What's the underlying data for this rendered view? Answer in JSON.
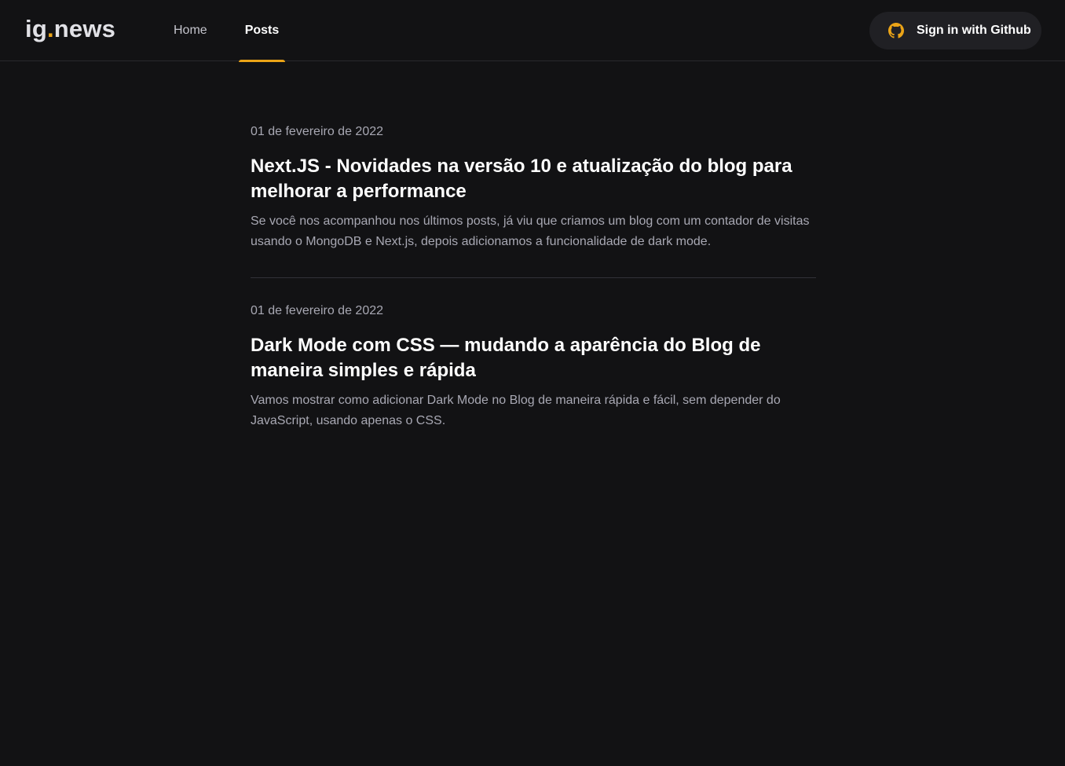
{
  "header": {
    "logo_text": "ig",
    "logo_dot": ".",
    "logo_suffix": "news",
    "nav": [
      {
        "label": "Home",
        "active": false
      },
      {
        "label": "Posts",
        "active": true
      }
    ],
    "signin_label": "Sign in with Github",
    "signin_icon": "github-icon",
    "accent_color": "#eba417"
  },
  "posts": [
    {
      "date": "01 de fevereiro de 2022",
      "title": "Next.JS - Novidades na versão 10 e atualização do blog para melhorar a performance",
      "excerpt": "Se você nos acompanhou nos últimos posts, já viu que criamos um blog com um contador de visitas usando o MongoDB e Next.js, depois adicionamos a funcionalidade de dark mode."
    },
    {
      "date": "01 de fevereiro de 2022",
      "title": "Dark Mode com CSS — mudando a aparência do Blog de maneira simples e rápida",
      "excerpt": "Vamos mostrar como adicionar Dark Mode no Blog de maneira rápida e fácil, sem depender do JavaScript, usando apenas o CSS."
    }
  ]
}
